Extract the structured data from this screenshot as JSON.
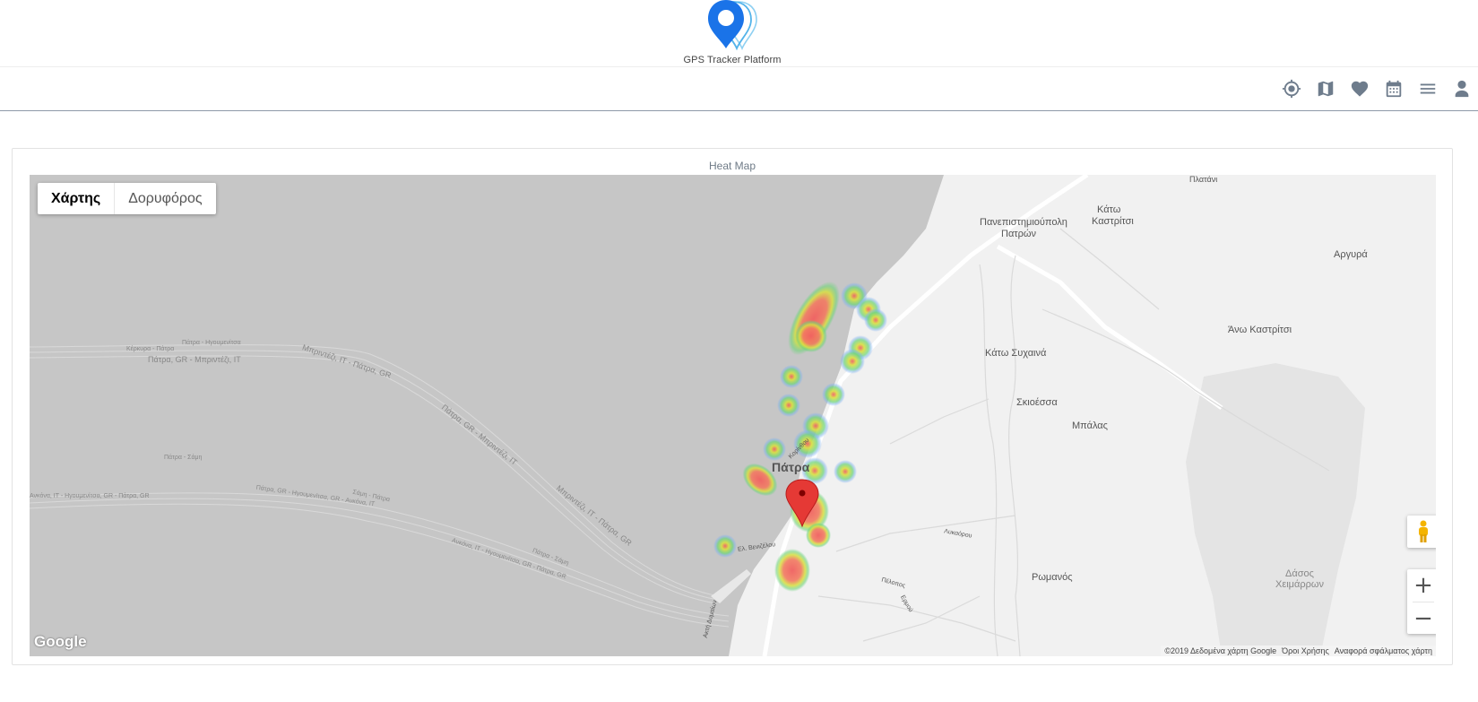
{
  "header": {
    "logo_text": "GPS Tracker Platform",
    "brand_color": "#1a73e8"
  },
  "nav": {
    "icons": [
      "crosshair-icon",
      "map-icon",
      "heart-icon",
      "calendar-icon",
      "menu-icon",
      "user-icon"
    ]
  },
  "card": {
    "title": "Heat Map"
  },
  "map": {
    "type_buttons": {
      "map": "Χάρτης",
      "satellite": "Δορυφόρος"
    },
    "zoom_in": "+",
    "zoom_out": "−",
    "google": "Google",
    "attribution": {
      "data": "©2019 Δεδομένα χάρτη Google",
      "terms": "Όροι Χρήσης",
      "report": "Αναφορά σφάλματος χάρτη"
    },
    "places": {
      "patra": "Πάτρα",
      "panepistimioupoli": "Πανεπιστημιούπολη",
      "patron": "Πατρών",
      "kato_kastritsi_1": "Κάτω",
      "kato_kastritsi_2": "Καστρίτσι",
      "argyra": "Αργυρά",
      "ano_kastritsi": "Άνω Καστρίτσι",
      "kato_sychaina": "Κάτω Συχαινά",
      "skioessa": "Σκιοέσσα",
      "bpalas": "Μπάλας",
      "romanos": "Ρωμανός",
      "dasos_1": "Δάσος",
      "dasos_2": "Χειμάρρων",
      "platani": "Πλατάνι"
    },
    "ferry_labels": [
      "Πάτρα, GR - Μπριντέζι, IT",
      "Κέρκυρα - Πάτρα",
      "Πάτρα - Ηγουμενίτσα",
      "Μπριντέζι, IT - Πάτρα, GR",
      "Πάτρα, GR - Μπριντέζι, IT",
      "Πάτρα - Σάμη",
      "Ανκόνα, IT - Ηγουμενίτσα, GR - Πάτρα, GR",
      "Πάτρα, GR - Ηγουμενίτσα, GR - Ανκόνα, IT",
      "Σάμη - Πάτρα",
      "Μπριντέζι, IT - Πάτρα, GR",
      "Ανκόνα, IT - Ηγουμενίτσα, GR - Πάτρα, GR",
      "Πάτρα - Σάμη"
    ],
    "street_labels": [
      "Ελ. Βενιζέλου",
      "Ακτή Δυμαίων",
      "Λυκαόρου",
      "Πέλοπος",
      "Ερμού",
      "Κορίνθου"
    ]
  }
}
